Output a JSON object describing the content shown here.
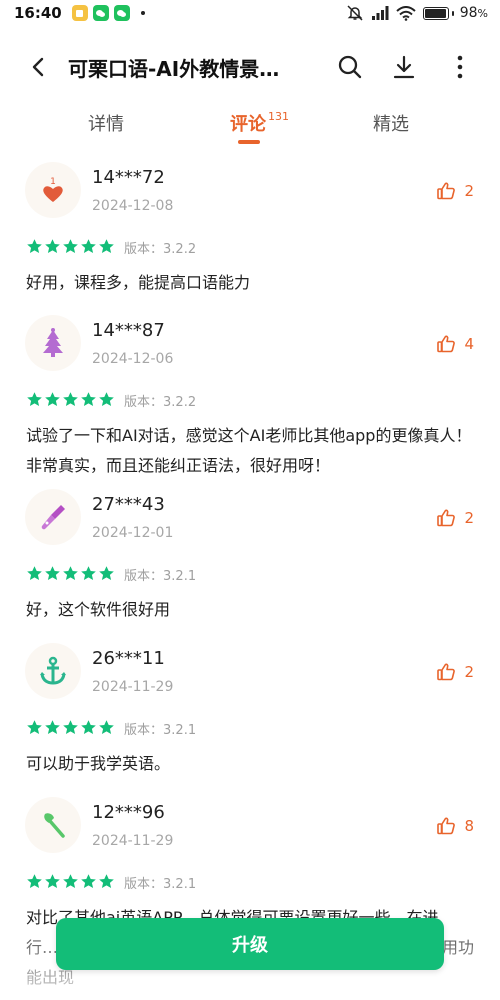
{
  "status_bar": {
    "time": "16:40",
    "battery_percent_label": "98",
    "battery_unit": "%",
    "battery_level": 0.98,
    "icons": [
      "notes-app-icon",
      "wechat-icon",
      "wechat-icon",
      "notification-dot",
      "mute-icon",
      "signal-icon",
      "wifi-icon",
      "battery-icon"
    ]
  },
  "header": {
    "title": "可栗口语-AI外教情景…",
    "back_icon": "back-arrow-icon",
    "search_icon": "search-icon",
    "download_icon": "download-icon",
    "more_icon": "more-vertical-icon"
  },
  "tabs": [
    {
      "label": "详情"
    },
    {
      "label": "评论",
      "count": "131",
      "active": true
    },
    {
      "label": "精选"
    }
  ],
  "version_prefix": "版本：",
  "reviews": [
    {
      "user": "14***72",
      "date": "2024-12-08",
      "likes": "2",
      "stars": 5,
      "version": "3.2.2",
      "text": "好用，课程多，能提高口语能力",
      "avatar": "heart-number-one-icon"
    },
    {
      "user": "14***87",
      "date": "2024-12-06",
      "likes": "4",
      "stars": 5,
      "version": "3.2.2",
      "text": "试验了一下和AI对话，感觉这个AI老师比其他app的更像真人！非常真实，而且还能纠正语法，很好用呀！",
      "avatar": "christmas-tree-icon"
    },
    {
      "user": "27***43",
      "date": "2024-12-01",
      "likes": "2",
      "stars": 5,
      "version": "3.2.1",
      "text": "好，这个软件很好用",
      "avatar": "screwdriver-icon"
    },
    {
      "user": "26***11",
      "date": "2024-11-29",
      "likes": "2",
      "stars": 5,
      "version": "3.2.1",
      "text": "可以助于我学英语。",
      "avatar": "anchor-icon"
    },
    {
      "user": "12***96",
      "date": "2024-11-29",
      "likes": "8",
      "stars": 5,
      "version": "3.2.1",
      "text": "对比了其他ai英语APP，总体觉得可栗设置更好一些，在进行……感好，……课程可以设置记忆曲线复习，期待更多好用功能出现",
      "avatar": "axe-icon"
    }
  ],
  "upgrade_button": {
    "label": "升级"
  },
  "colors": {
    "accent": "#e8642c",
    "star": "#13bd78",
    "button": "#13bd78"
  }
}
